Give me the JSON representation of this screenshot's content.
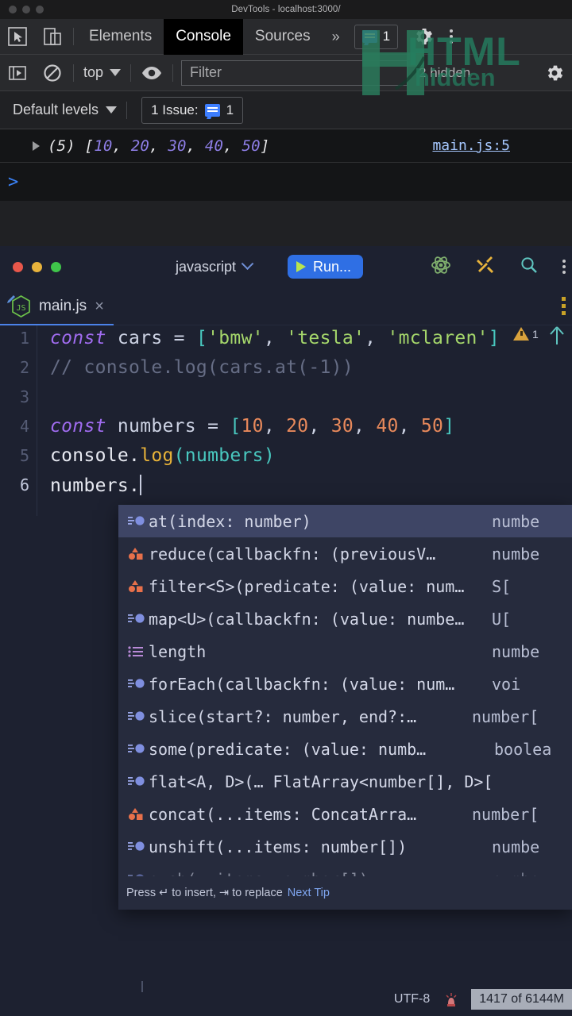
{
  "devtools": {
    "window_title": "DevTools - localhost:3000/",
    "toolbar": {
      "inspect_icon": "inspect-cursor-icon",
      "device_icon": "device-toolbar-icon",
      "tabs": [
        {
          "label": "Elements",
          "active": false
        },
        {
          "label": "Console",
          "active": true
        },
        {
          "label": "Sources",
          "active": false
        }
      ],
      "more_tabs_label": "»",
      "issues_count": "1",
      "settings_icon": "gear-icon",
      "menu_icon": "kebab-menu-icon"
    },
    "filterbar": {
      "sidebar_icon": "sidebar-toggle-icon",
      "clear_icon": "clear-console-icon",
      "context_label": "top",
      "eye_icon": "live-expression-eye-icon",
      "filter_placeholder": "Filter",
      "hidden_label": "2 hidden",
      "settings_icon": "console-settings-gear-icon"
    },
    "levelbar": {
      "levels_label": "Default levels",
      "issue_label": "1 Issue:",
      "issue_count": "1"
    },
    "log": {
      "prefix": "(5)",
      "value": "[10, 20, 30, 40, 50]",
      "array_length": "(5)",
      "items": [
        "10",
        "20",
        "30",
        "40",
        "50"
      ],
      "source": "main.js:5",
      "prompt": ">"
    },
    "watermark": {
      "line1": "HTML",
      "line2": "hidden"
    }
  },
  "editor": {
    "toolbar": {
      "language": "javascript",
      "run_label": "Run...",
      "atom_icon": "atom-icon",
      "tools_icon": "hammer-tools-icon",
      "search_icon": "search-icon",
      "menu_icon": "kebab-menu-icon"
    },
    "tab": {
      "filename": "main.js",
      "close_label": "×",
      "badge": "JS"
    },
    "lines": [
      {
        "n": "1",
        "current": false
      },
      {
        "n": "2",
        "current": false
      },
      {
        "n": "3",
        "current": false
      },
      {
        "n": "4",
        "current": false
      },
      {
        "n": "5",
        "current": false
      },
      {
        "n": "6",
        "current": true
      }
    ],
    "code": {
      "l1_kw": "const",
      "l1_var": " cars ",
      "l1_eq": "= ",
      "l1_open": "[",
      "l1_s1": "'bmw'",
      "l1_c1": ", ",
      "l1_s2": "'tesla'",
      "l1_c2": ", ",
      "l1_s3": "'mclaren'",
      "l1_close": "]",
      "l2": "// console.log(cars.at(-1))",
      "l4_kw": "const",
      "l4_var": " numbers ",
      "l4_eq": "= ",
      "l4_open": "[",
      "l4_n1": "10",
      "l4_c1": ", ",
      "l4_n2": "20",
      "l4_c2": ", ",
      "l4_n3": "30",
      "l4_c3": ", ",
      "l4_n4": "40",
      "l4_c4": ", ",
      "l4_n5": "50",
      "l4_close": "]",
      "l5_obj": "console",
      "l5_dot": ".",
      "l5_fn": "log",
      "l5_open": "(",
      "l5_arg": "numbers",
      "l5_close": ")",
      "l6": "numbers."
    },
    "warning": {
      "count": "1",
      "icon": "warning-triangle-icon",
      "scroll_icon": "up-arrow-icon"
    },
    "autocomplete": {
      "items": [
        {
          "icon": "method-icon",
          "label": "at(index: number)",
          "type": "numbe",
          "selected": true
        },
        {
          "icon": "property-icon",
          "label": "reduce(callbackfn: (previousV…",
          "type": "numbe",
          "selected": false
        },
        {
          "icon": "property-icon",
          "label": "filter<S>(predicate: (value: num…",
          "type": "S[",
          "selected": false
        },
        {
          "icon": "method-icon",
          "label": "map<U>(callbackfn: (value: numbe…",
          "type": "U[",
          "selected": false
        },
        {
          "icon": "field-icon",
          "label": "length",
          "type": "numbe",
          "selected": false
        },
        {
          "icon": "method-icon",
          "label": "forEach(callbackfn: (value: num…",
          "type": "voi",
          "selected": false
        },
        {
          "icon": "method-icon",
          "label": "slice(start?: number, end?:…",
          "type": "number[",
          "selected": false
        },
        {
          "icon": "method-icon",
          "label": "some(predicate: (value: numb…",
          "type": "boolea",
          "selected": false
        },
        {
          "icon": "method-icon",
          "label": "flat<A, D>(…  FlatArray<number[], D>[",
          "type": "",
          "selected": false
        },
        {
          "icon": "property-icon",
          "label": "concat(...items: ConcatArra…",
          "type": "number[",
          "selected": false
        },
        {
          "icon": "method-icon",
          "label": "unshift(...items: number[])",
          "type": "numbe",
          "selected": false
        },
        {
          "icon": "method-icon",
          "label": "push(… items: number[])",
          "type": "numbe",
          "selected": false
        }
      ],
      "footer_text": "Press ↵ to insert, ⇥ to replace",
      "footer_link": "Next Tip"
    }
  },
  "statusbar": {
    "encoding": "UTF-8",
    "siren_icon": "siren-alert-icon",
    "memory": "1417 of 6144M"
  }
}
